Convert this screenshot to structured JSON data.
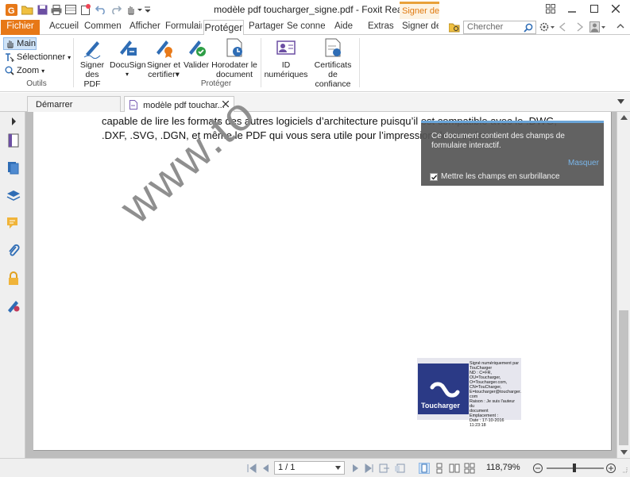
{
  "window": {
    "title": "modèle pdf toucharger_signe.pdf - Foxit Reader",
    "context_tab": "Signer de..."
  },
  "tabs": [
    "Fichier",
    "Accueil",
    "Commenta",
    "Afficher",
    "Formulaire",
    "Protéger",
    "Partager",
    "Se connect",
    "Aide",
    "Extras",
    "Signer des"
  ],
  "search": {
    "placeholder": "Chercher"
  },
  "ribbon": {
    "outils": {
      "main": "Main",
      "select": "Sélectionner",
      "zoom": "Zoom",
      "label": "Outils"
    },
    "proteger": {
      "label": "Protéger",
      "buttons": [
        {
          "l1": "Signer",
          "l2": "des PDF"
        },
        {
          "l1": "DocuSign",
          "l2": "▾"
        },
        {
          "l1": "Signer et",
          "l2": "certifier▾"
        },
        {
          "l1": "Valider",
          "l2": ""
        },
        {
          "l1": "Horodater le",
          "l2": "document"
        },
        {
          "l1": "ID",
          "l2": "numériques"
        },
        {
          "l1": "Certificats",
          "l2": "de confiance"
        }
      ]
    }
  },
  "doc_tabs": {
    "start": "Démarrer",
    "current": "modèle pdf touchar..."
  },
  "document": {
    "line1": "capable de lire les formats des autres logiciels d’architecture puisqu’il est compatible avec le .DWG,",
    "line2": ".DXF, .SVG, .DGN, et même le PDF qui vous sera utile pour l’impression de vos plans.",
    "watermark": "www.to"
  },
  "notification": {
    "message": "Ce document contient des champs de formulaire interactif.",
    "hide": "Masquer",
    "checkbox": "Mettre les champs en surbrillance",
    "checked": true
  },
  "signature": {
    "logo_text": "Toucharger",
    "details": [
      "Signé numériquement par",
      "TouCharger",
      "ND : C=FR,",
      "OU=Toucharger,",
      "O=Toucharger.com,",
      "CN=TouCharger,",
      "E=toucharger@toucharger.",
      "com",
      "Raison : Je suis l'auteur du",
      "document",
      "Emplacement :",
      "Date : 17-10-2016 11:23:18"
    ]
  },
  "statusbar": {
    "page": "1 / 1",
    "zoom": "118,79%"
  },
  "colors": {
    "accent": "#e77817",
    "link_blue": "#1f4e9c",
    "notif_bg": "#555555"
  }
}
